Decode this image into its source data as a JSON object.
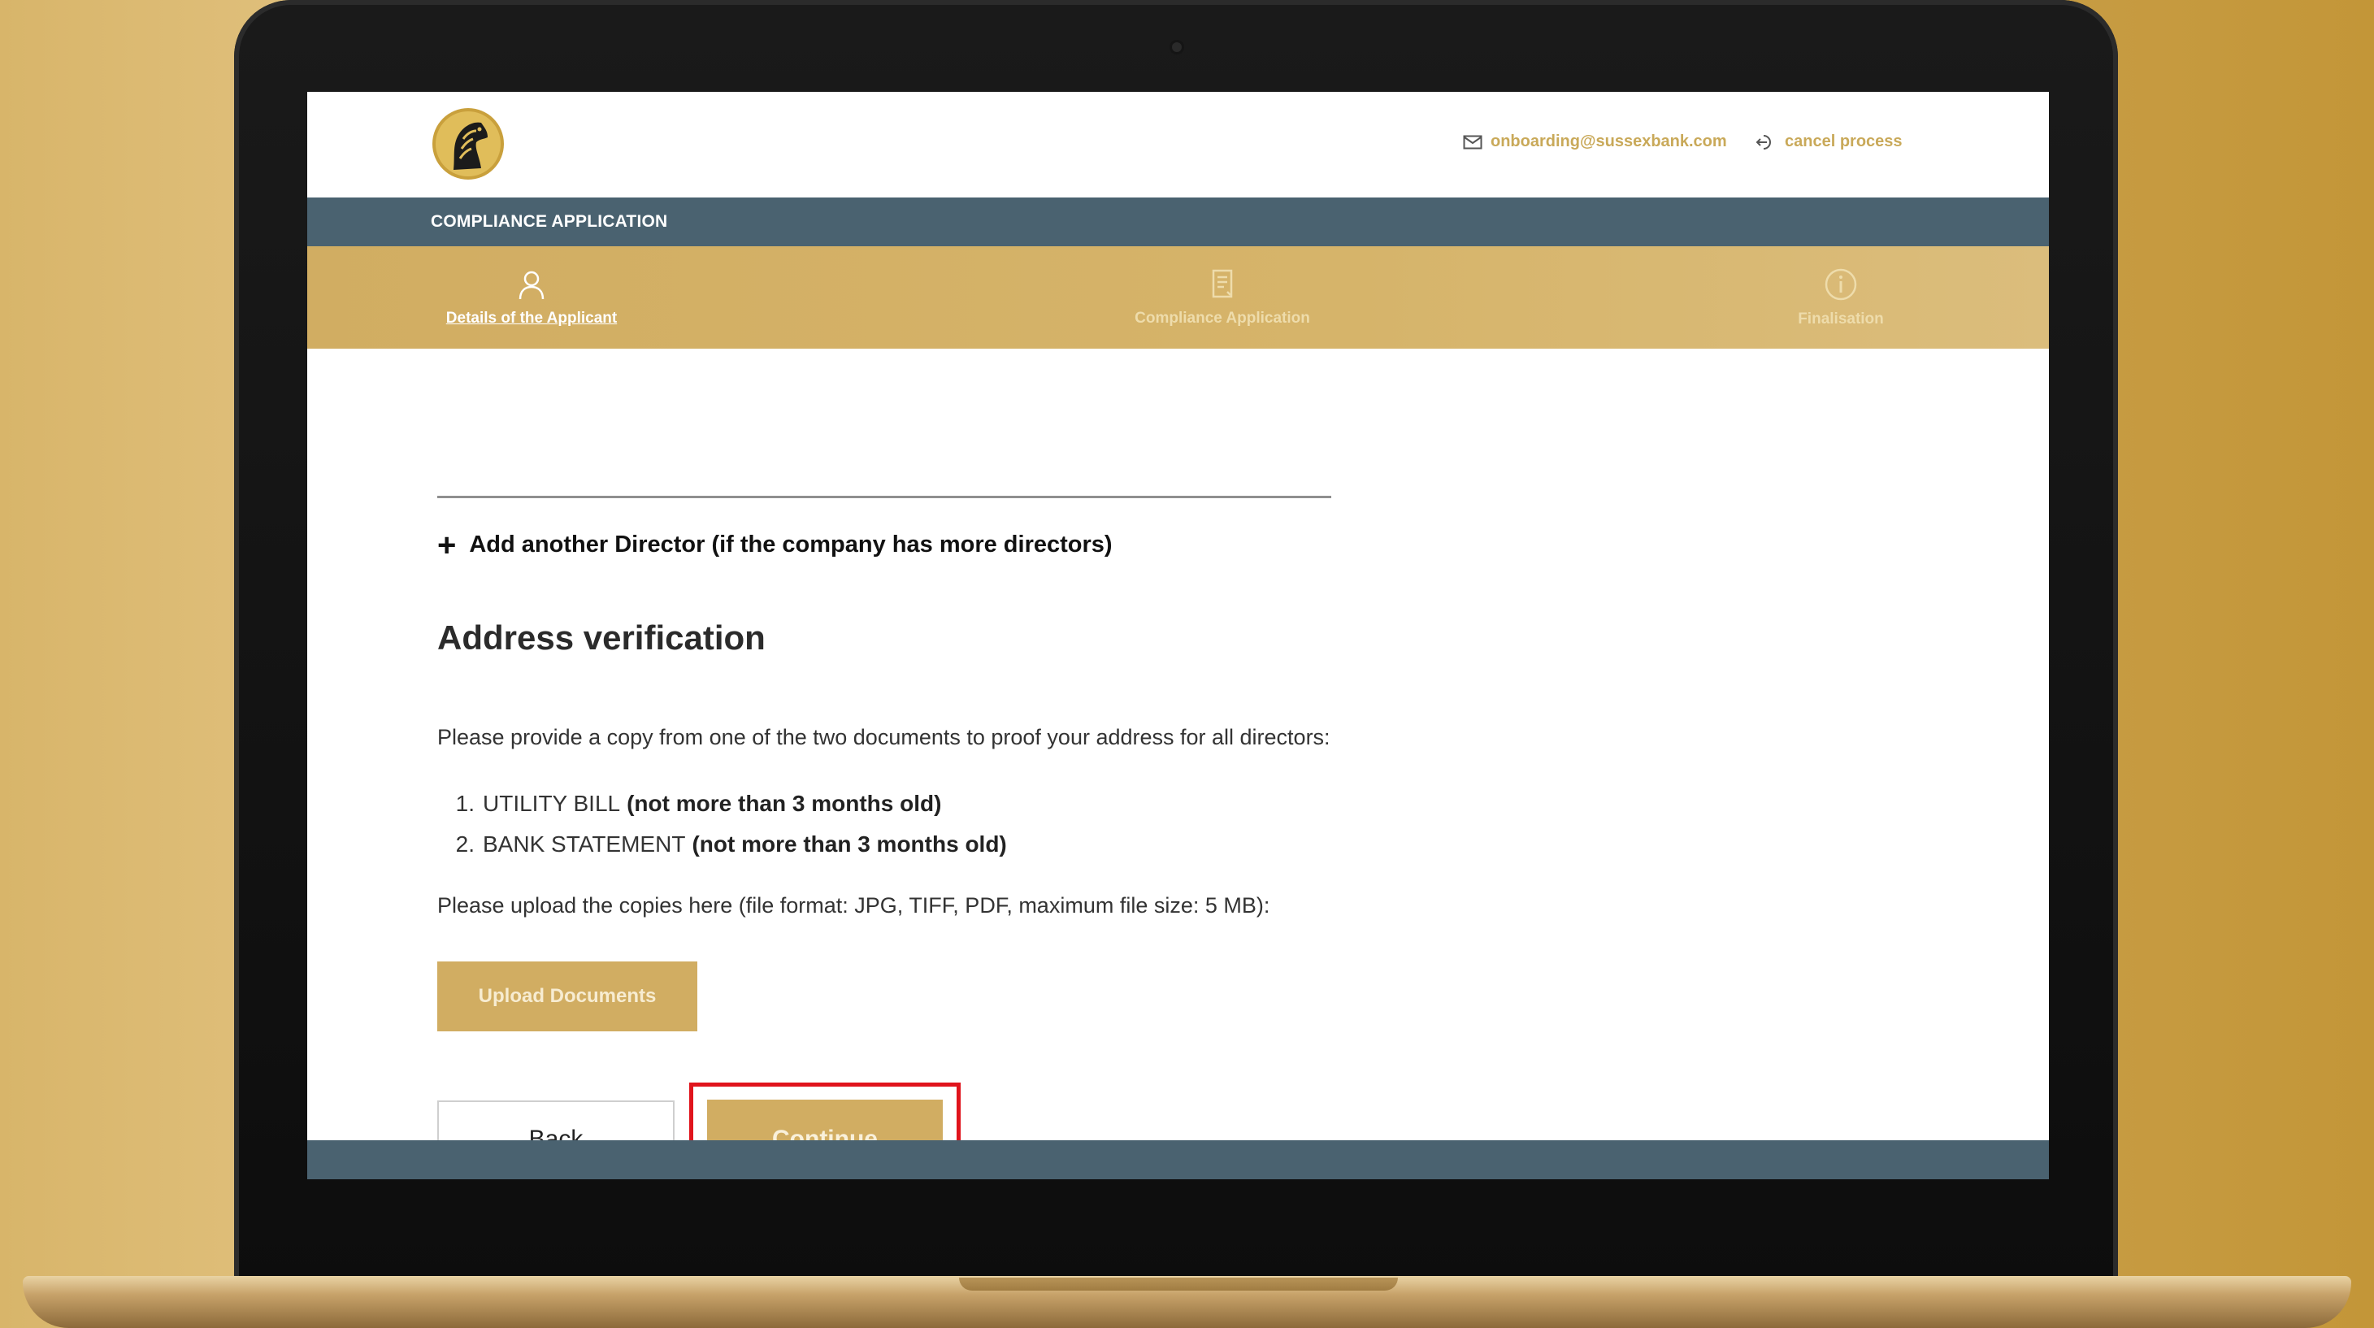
{
  "header": {
    "contact_email": "onboarding@sussexbank.com",
    "cancel_label": "cancel process"
  },
  "app_bar": {
    "title": "COMPLIANCE APPLICATION"
  },
  "steps": [
    {
      "label": "Details of the Applicant",
      "icon": "person-icon",
      "active": true
    },
    {
      "label": "Compliance Application",
      "icon": "document-icon",
      "active": false
    },
    {
      "label": "Finalisation",
      "icon": "info-icon",
      "active": false
    }
  ],
  "form": {
    "add_director_label": "Add another Director (if the company has more directors)",
    "section_title": "Address verification",
    "instruction": "Please provide a copy from one of the two documents to proof your address for all directors:",
    "documents": [
      {
        "number": "1.",
        "name": "UTILITY BILL",
        "note": "(not more than 3 months old)"
      },
      {
        "number": "2.",
        "name": "BANK STATEMENT",
        "note": "(not more than 3 months old)"
      }
    ],
    "upload_instruction": "Please upload the copies here (file format: JPG, TIFF, PDF, maximum file size: 5 MB):",
    "upload_button_label": "Upload Documents",
    "back_button_label": "Back",
    "continue_button_label": "Continue"
  },
  "colors": {
    "gold": "#d1ad62",
    "slate": "#4a6270",
    "highlight": "#e0141c"
  }
}
